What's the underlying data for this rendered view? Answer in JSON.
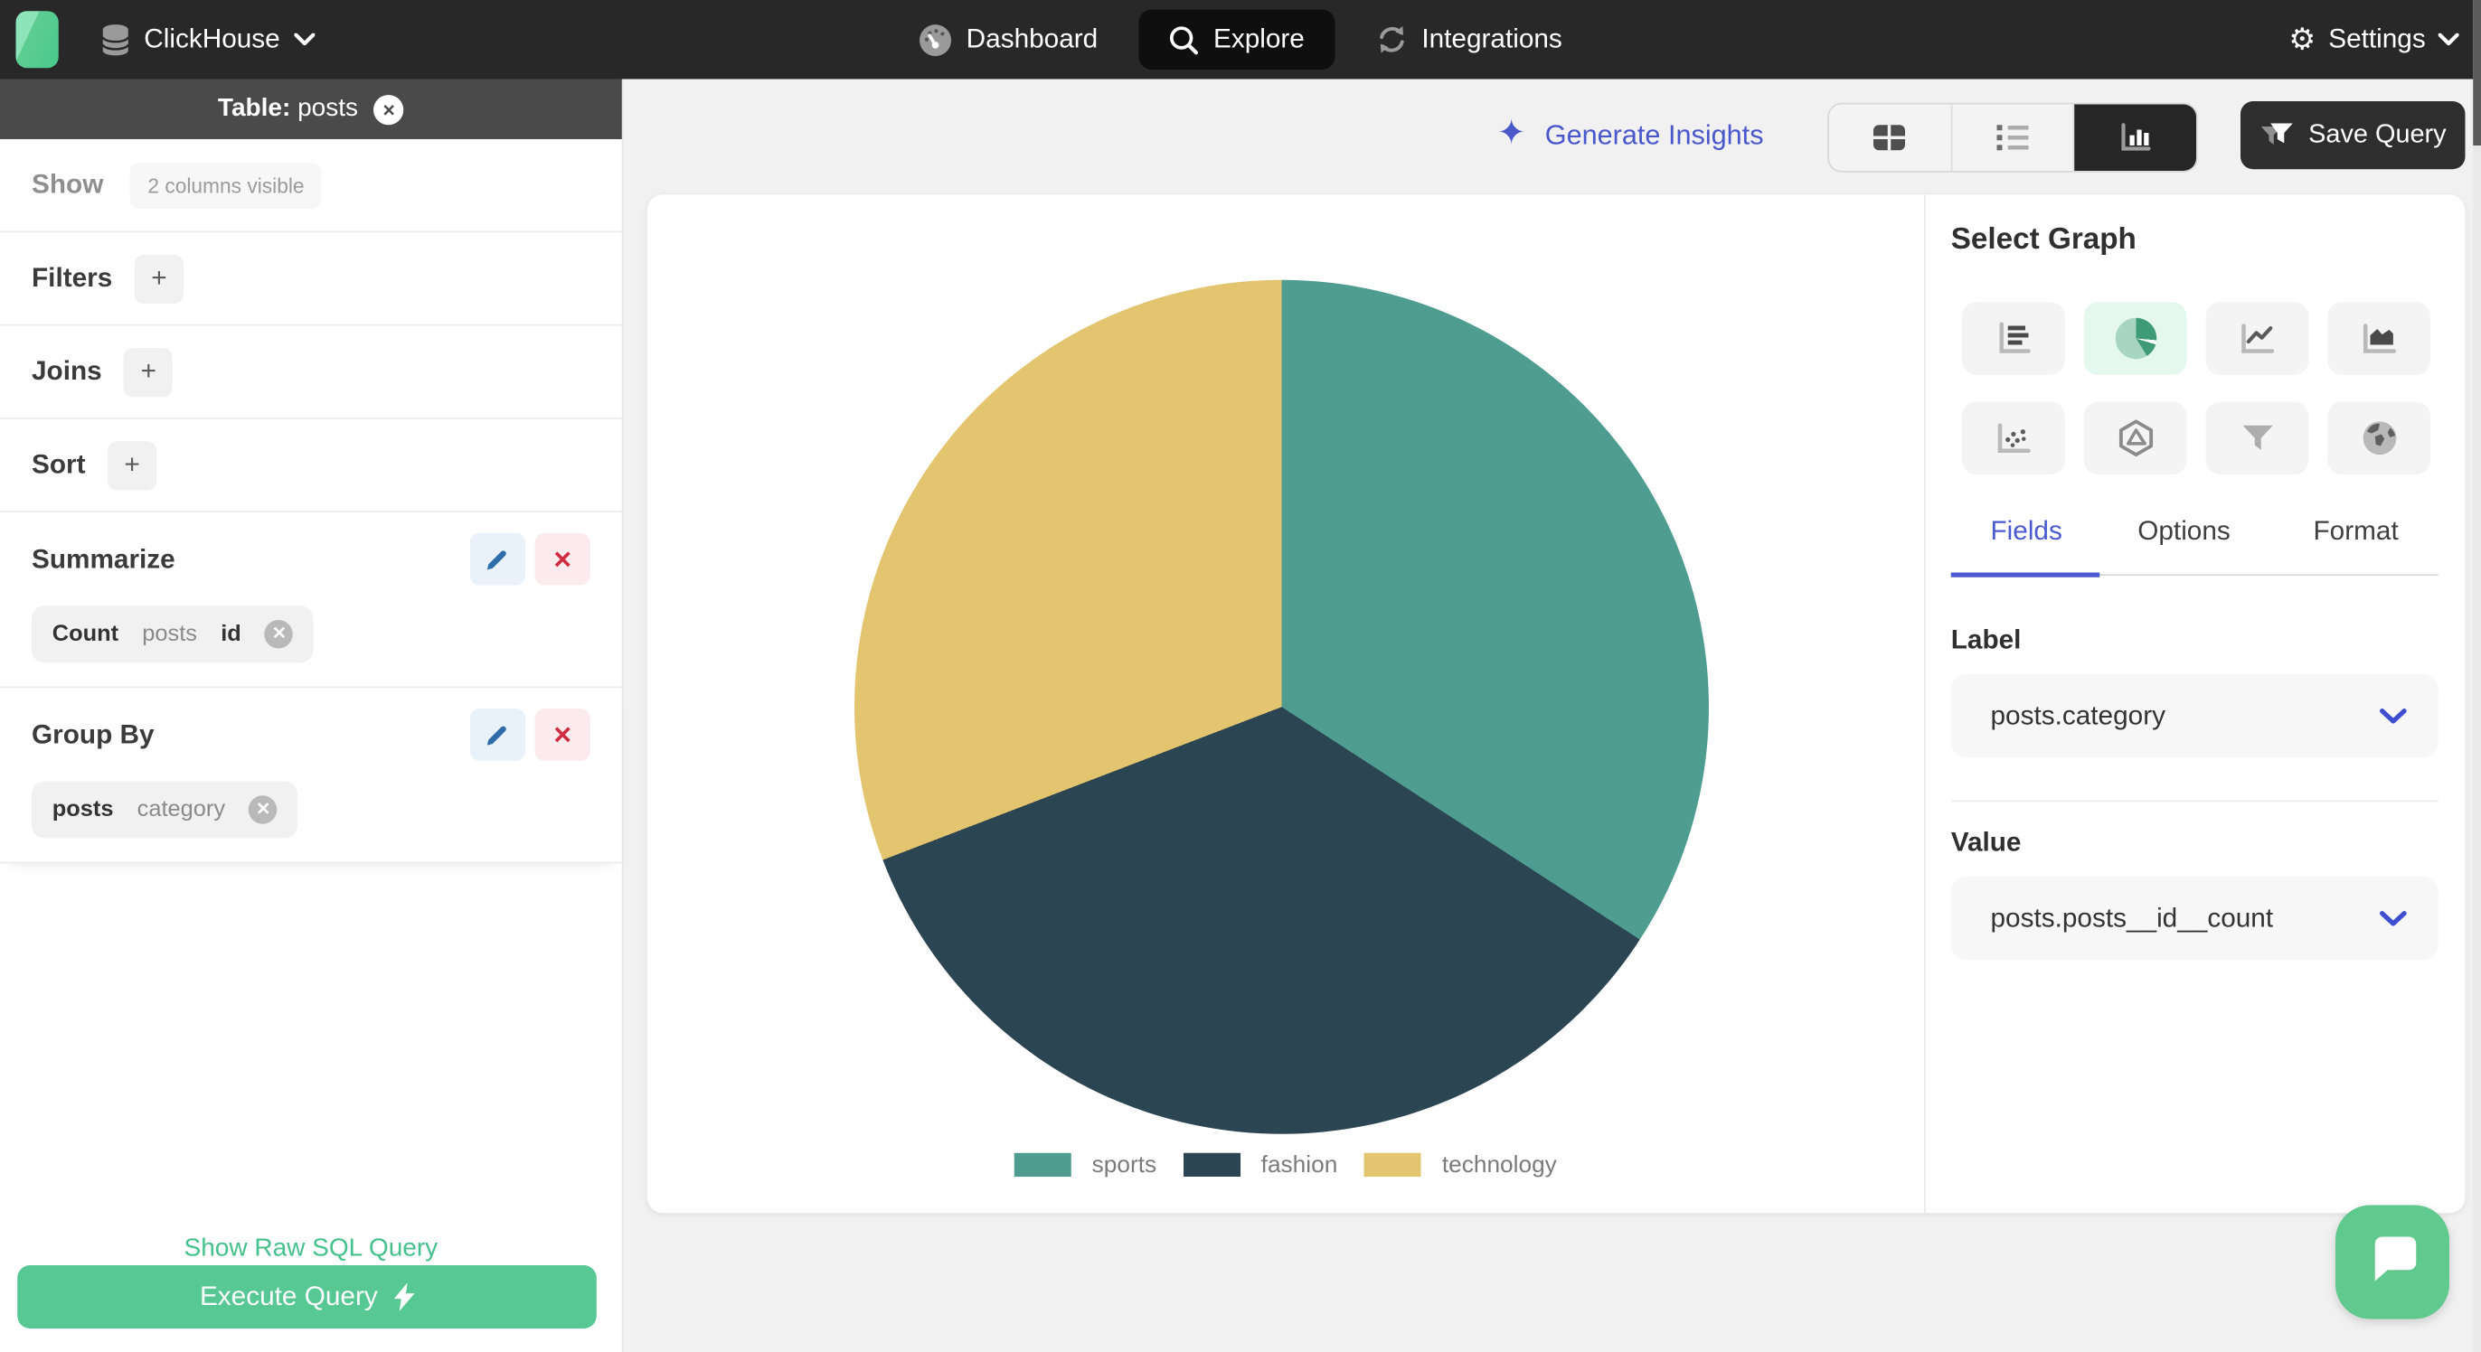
{
  "glyphs": {
    "plus": "+",
    "close": "×",
    "remove_x": "✕",
    "sparkle": "✦",
    "gear": "⚙"
  },
  "colors": {
    "topbar": "#282828",
    "accent_green": "#57c793",
    "link_green": "#45c18c",
    "accent_blue": "#4b58cc",
    "tab_blue": "#4c5ad2",
    "pie_sports": "#4f9d90",
    "pie_fashion": "#2c4552",
    "pie_technology": "#e3c46f"
  },
  "topbar": {
    "app_name": "ClickHouse",
    "nav": [
      {
        "label": "Dashboard",
        "active": false
      },
      {
        "label": "Explore",
        "active": true
      },
      {
        "label": "Integrations",
        "active": false
      }
    ],
    "settings": {
      "label": "Settings"
    }
  },
  "sidebar": {
    "table_header": {
      "prefix": "Table:",
      "table": "posts"
    },
    "show": {
      "label": "Show",
      "badge": "2 columns visible"
    },
    "filters": {
      "label": "Filters"
    },
    "joins": {
      "label": "Joins"
    },
    "sort": {
      "label": "Sort"
    },
    "summarize": {
      "label": "Summarize",
      "chip": {
        "agg": "Count",
        "table": "posts",
        "column": "id"
      }
    },
    "group_by": {
      "label": "Group By",
      "chip": {
        "table": "posts",
        "column": "category"
      }
    },
    "raw_sql_link": "Show Raw SQL Query",
    "execute_button": "Execute Query"
  },
  "toolbar": {
    "generate_insights": "Generate Insights",
    "views": [
      "table",
      "list",
      "chart"
    ],
    "active_view": "chart",
    "save_query": "Save Query"
  },
  "graph_panel": {
    "title": "Select Graph",
    "types": [
      "bar",
      "pie",
      "line",
      "area",
      "scatter",
      "radar",
      "funnel",
      "map"
    ],
    "active_type": "pie",
    "tabs": [
      {
        "label": "Fields",
        "active": true
      },
      {
        "label": "Options",
        "active": false
      },
      {
        "label": "Format",
        "active": false
      }
    ],
    "label_section": {
      "title": "Label",
      "value": "posts.category"
    },
    "value_section": {
      "title": "Value",
      "value": "posts.posts__id__count"
    }
  },
  "chart_data": {
    "type": "pie",
    "title": "",
    "categories": [
      "sports",
      "fashion",
      "technology"
    ],
    "values_percent_estimated": [
      34,
      35,
      31
    ],
    "slices": [
      {
        "label": "sports",
        "color": "#4f9d90",
        "start_deg": 0,
        "end_deg": 123
      },
      {
        "label": "fashion",
        "color": "#2c4552",
        "start_deg": 123,
        "end_deg": 249
      },
      {
        "label": "technology",
        "color": "#e3c46f",
        "start_deg": 249,
        "end_deg": 360
      }
    ],
    "legend_position": "bottom"
  }
}
